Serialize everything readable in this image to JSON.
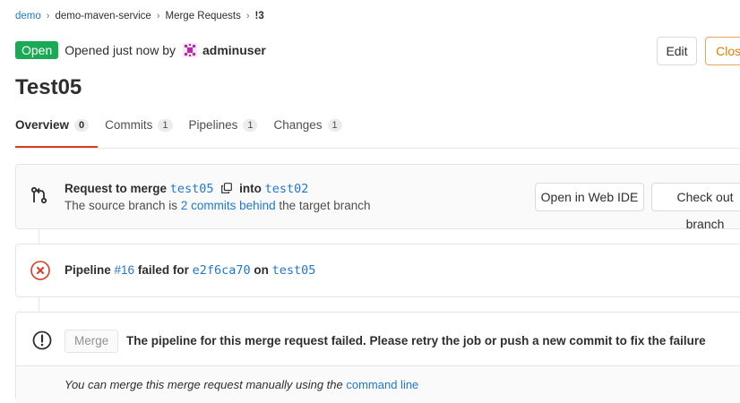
{
  "breadcrumb": [
    "demo",
    "demo-maven-service",
    "Merge Requests",
    "!3"
  ],
  "status": {
    "badge": "Open",
    "opened_text": "Opened just now by",
    "author": "adminuser"
  },
  "header_buttons": {
    "edit": "Edit",
    "close": "Close"
  },
  "title": "Test05",
  "tabs": [
    {
      "label": "Overview",
      "count": "0"
    },
    {
      "label": "Commits",
      "count": "1"
    },
    {
      "label": "Pipelines",
      "count": "1"
    },
    {
      "label": "Changes",
      "count": "1"
    }
  ],
  "merge_request": {
    "prefix": "Request to merge",
    "source_branch": "test05",
    "into": "into",
    "target_branch": "test02",
    "line2_prefix": "The source branch is",
    "behind_link": "2 commits behind",
    "line2_suffix": "the target branch",
    "open_web_ide": "Open in Web IDE",
    "check_out_branch": "Check out branch"
  },
  "pipeline": {
    "prefix": "Pipeline",
    "id": "#16",
    "failed_for": "failed for",
    "commit": "e2f6ca70",
    "on": "on",
    "branch": "test05"
  },
  "merge_box": {
    "merge_button": "Merge",
    "message": "The pipeline for this merge request failed. Please retry the job or push a new commit to fix the failure",
    "manual_text": "You can merge this merge request manually using the",
    "manual_link": "command line"
  },
  "colors": {
    "open_badge": "#1aaa55",
    "link": "#1f78d1",
    "danger": "#db3b21",
    "close_button": "#de7e00"
  }
}
